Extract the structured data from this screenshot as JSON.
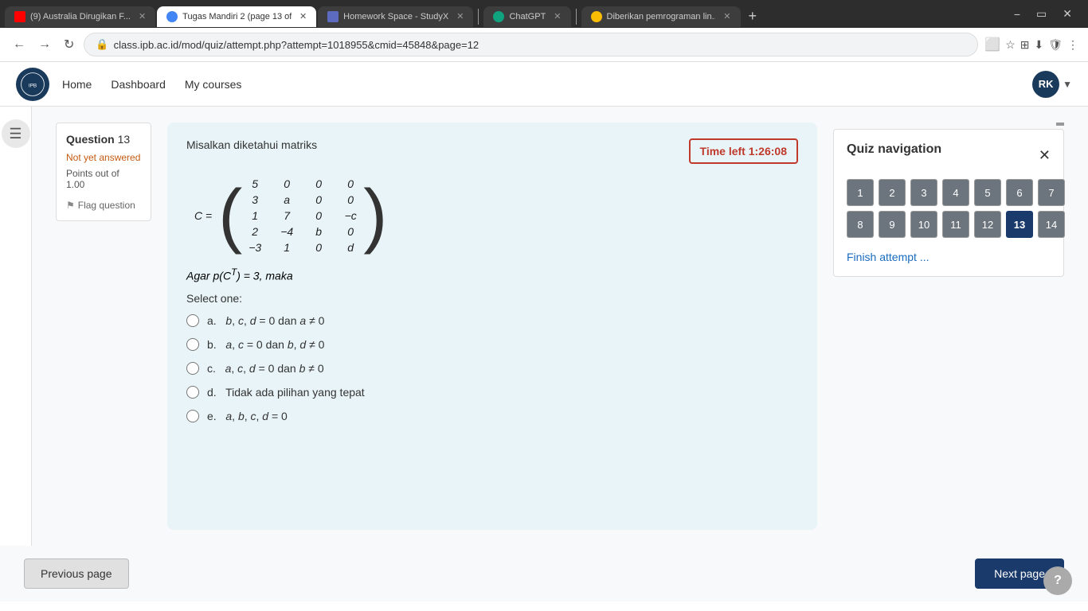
{
  "browser": {
    "tabs": [
      {
        "id": "yt",
        "label": "(9) Australia Dirugikan F...",
        "active": false,
        "favicon_type": "yt"
      },
      {
        "id": "tugas",
        "label": "Tugas Mandiri 2 (page 13 of...",
        "active": true,
        "favicon_type": "tugas"
      },
      {
        "id": "hw",
        "label": "Homework Space - StudyX",
        "active": false,
        "favicon_type": "hw"
      },
      {
        "id": "chatgpt",
        "label": "ChatGPT",
        "active": false,
        "favicon_type": "chatgpt"
      },
      {
        "id": "google",
        "label": "Diberikan pemrograman lin...",
        "active": false,
        "favicon_type": "google"
      }
    ],
    "url": "class.ipb.ac.id/mod/quiz/attempt.php?attempt=1018955&cmid=45848&page=12"
  },
  "nav": {
    "links": [
      "Home",
      "Dashboard",
      "My courses"
    ],
    "user_initials": "RK"
  },
  "question": {
    "number": "13",
    "status": "Not yet answered",
    "points_label": "Points out of",
    "points_value": "1.00",
    "flag_label": "Flag question"
  },
  "quiz": {
    "intro": "Misalkan diketahui matriks",
    "time_left": "Time left 1:26:08",
    "variable": "C",
    "matrix": {
      "rows": [
        [
          "5",
          "0",
          "0",
          "0"
        ],
        [
          "3",
          "a",
          "0",
          "0"
        ],
        [
          "1",
          "7",
          "0",
          "−c"
        ],
        [
          "2",
          "−4",
          "b",
          "0"
        ],
        [
          "−3",
          "1",
          "0",
          "d"
        ]
      ]
    },
    "condition": "Agar p(C",
    "condition_sup": "T",
    "condition_rest": ") = 3, maka",
    "select_label": "Select one:",
    "options": [
      {
        "key": "a",
        "text": "b, c, d = 0 dan a ≠ 0"
      },
      {
        "key": "b",
        "text": "a, c = 0 dan b, d ≠ 0"
      },
      {
        "key": "c",
        "text": "a, c, d = 0 dan b ≠ 0"
      },
      {
        "key": "d",
        "text": "Tidak ada pilihan yang tepat"
      },
      {
        "key": "e",
        "text": "a, b, c, d = 0"
      }
    ]
  },
  "navigation": {
    "prev_label": "Previous page",
    "next_label": "Next page"
  },
  "quiz_nav": {
    "title": "Quiz navigation",
    "numbers": [
      1,
      2,
      3,
      4,
      5,
      6,
      7,
      8,
      9,
      10,
      11,
      12,
      13,
      14
    ],
    "active": 13,
    "finish_label": "Finish attempt ..."
  }
}
